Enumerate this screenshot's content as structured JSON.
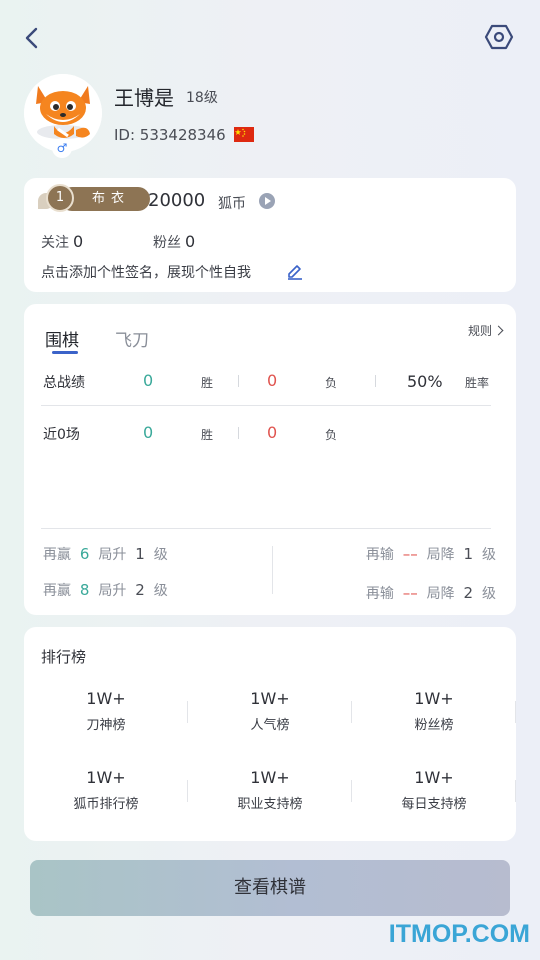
{
  "header": {
    "back_icon": "chevron-left-icon",
    "settings_icon": "hexagon-settings-icon"
  },
  "profile": {
    "name": "王博是",
    "level": "18级",
    "id_text": "ID: 533428346",
    "gender_symbol": "♂",
    "flag_icon": "china-flag-icon"
  },
  "summary": {
    "rank_number": "1",
    "rank_name": "布衣",
    "coins": "20000",
    "coins_unit": "狐币",
    "follow_label": "关注",
    "follow_count": "0",
    "fans_label": "粉丝",
    "fans_count": "0",
    "signature": "点击添加个性签名，展现个性自我"
  },
  "record": {
    "tabs": [
      "围棋",
      "飞刀"
    ],
    "rules_label": "规则",
    "total": {
      "label": "总战绩",
      "wins": "0",
      "win_unit": "胜",
      "losses": "0",
      "loss_unit": "负",
      "rate": "50%",
      "rate_unit": "胜率"
    },
    "recent": {
      "label": "近0场",
      "wins": "0",
      "win_unit": "胜",
      "losses": "0",
      "loss_unit": "负"
    },
    "rules": {
      "up1": {
        "prefix": "再赢",
        "count": "6",
        "action": "局升",
        "num": "1",
        "suffix": "级"
      },
      "up2": {
        "prefix": "再赢",
        "count": "8",
        "action": "局升",
        "num": "2",
        "suffix": "级"
      },
      "down1": {
        "prefix": "再输",
        "count": "––",
        "action": "局降",
        "num": "1",
        "suffix": "级"
      },
      "down2": {
        "prefix": "再输",
        "count": "––",
        "action": "局降",
        "num": "2",
        "suffix": "级"
      }
    }
  },
  "leaderboard": {
    "title": "排行榜",
    "items": [
      {
        "value": "1W+",
        "label": "刀神榜"
      },
      {
        "value": "1W+",
        "label": "人气榜"
      },
      {
        "value": "1W+",
        "label": "粉丝榜"
      },
      {
        "value": "1W+",
        "label": "狐币排行榜"
      },
      {
        "value": "1W+",
        "label": "职业支持榜"
      },
      {
        "value": "1W+",
        "label": "每日支持榜"
      }
    ]
  },
  "main_button": "查看棋谱",
  "watermark": "ITMOP.COM",
  "colors": {
    "win": "#3aa99a",
    "lose": "#e0544f",
    "accent": "#3b63c9",
    "rank": "#8d7454"
  }
}
